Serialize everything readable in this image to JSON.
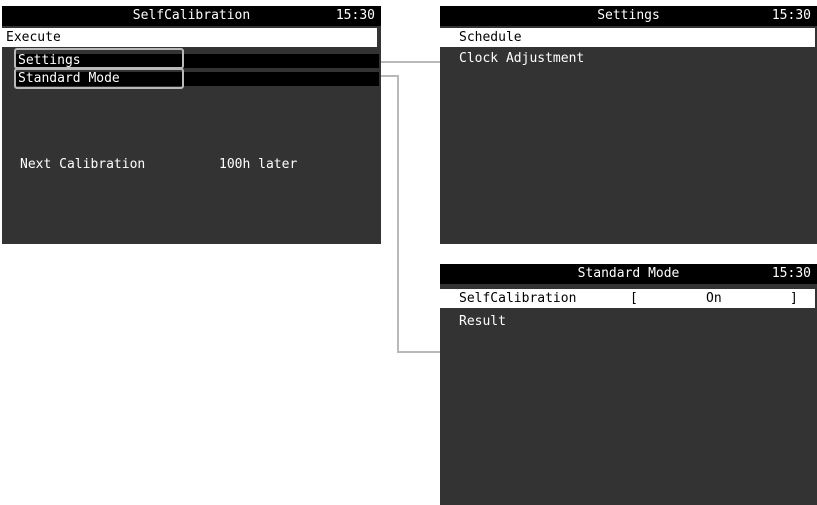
{
  "panel_main": {
    "title": "SelfCalibration",
    "time": "15:30",
    "items": {
      "execute": "Execute",
      "settings": "Settings",
      "standard_mode": "Standard Mode"
    },
    "next_calibration_label": "Next Calibration",
    "next_calibration_value": "100h later"
  },
  "panel_settings": {
    "title": "Settings",
    "time": "15:30",
    "items": {
      "schedule": "Schedule",
      "clock_adjustment": "Clock Adjustment"
    }
  },
  "panel_standard": {
    "title": "Standard Mode",
    "time": "15:30",
    "rows": {
      "selfcalibration_label": "SelfCalibration",
      "bracket_open": "[",
      "selfcalibration_value": "On",
      "bracket_close": "]",
      "result_label": "Result"
    }
  },
  "colors": {
    "panel_bg": "#333333",
    "title_bg": "#000000",
    "highlight_bg": "#ffffff",
    "callout": "#b9b9b9"
  }
}
